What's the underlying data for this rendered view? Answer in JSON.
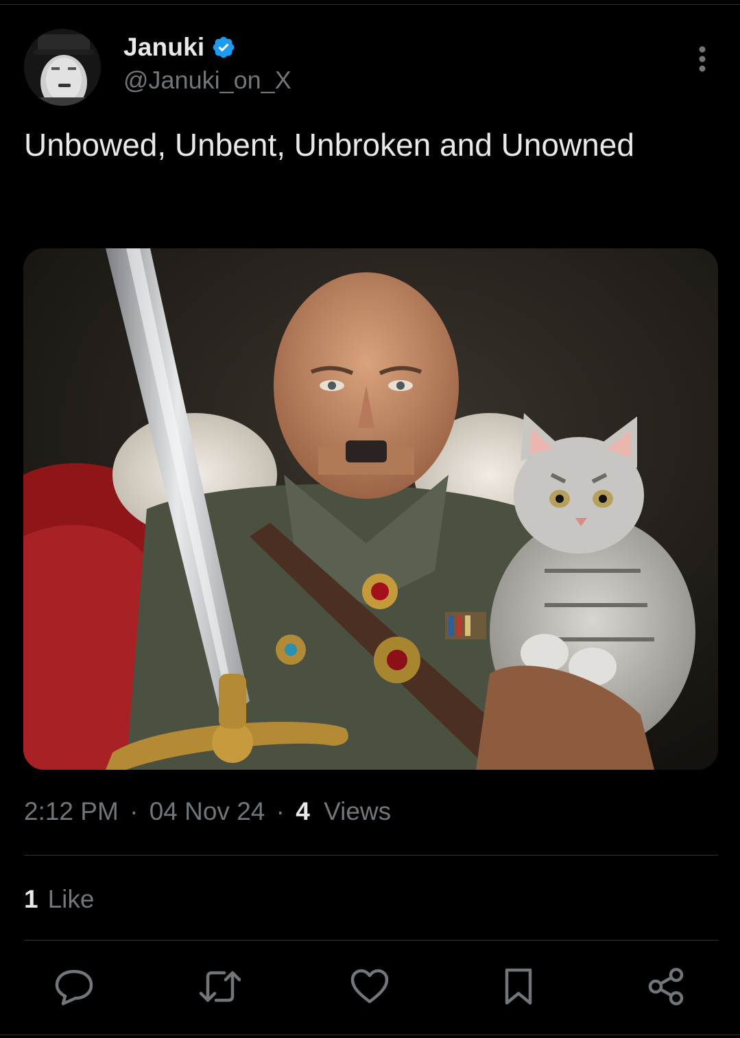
{
  "colors": {
    "background": "#000000",
    "primary_text": "#e7e9ea",
    "secondary_text": "#71767b",
    "divider": "#2f3336",
    "verified_badge": "#1d9bf0"
  },
  "author": {
    "display_name": "Januki",
    "handle": "@Januki_on_X",
    "verified": true,
    "avatar_icon": "avatar-portrait"
  },
  "tweet": {
    "text": "Unbowed, Unbent, Unbroken and Unowned",
    "media_icon": "ai-portrait-image"
  },
  "meta": {
    "time": "2:12 PM",
    "separator": "·",
    "date": "04 Nov 24",
    "views_count": "4",
    "views_label": "Views"
  },
  "engagement": {
    "likes_count": "1",
    "likes_label": "Like"
  },
  "actions": [
    {
      "name": "reply",
      "icon": "speech-bubble-icon"
    },
    {
      "name": "repost",
      "icon": "repost-arrows-icon"
    },
    {
      "name": "like",
      "icon": "heart-icon"
    },
    {
      "name": "bookmark",
      "icon": "bookmark-icon"
    },
    {
      "name": "share",
      "icon": "share-nodes-icon"
    }
  ]
}
